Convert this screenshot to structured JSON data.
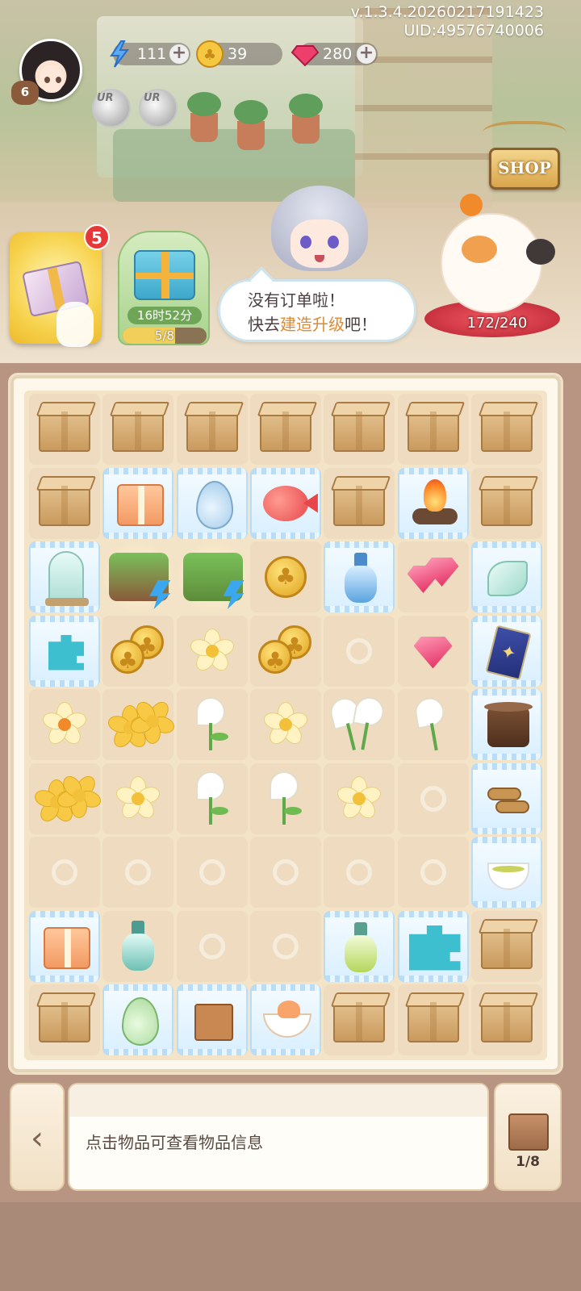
{
  "header": {
    "version": "v.1.3.4.20260217191423",
    "uid": "UID:49576740006",
    "player_level": "6",
    "energy": "111",
    "coins": "39",
    "gems": "280",
    "badge_1": "UR",
    "badge_2": "UR",
    "shop_label": "SHOP"
  },
  "gift_button": {
    "notification_count": "5"
  },
  "timed_chest": {
    "timer": "16时52分",
    "progress": "5/8",
    "progress_fraction": 0.625
  },
  "dialog": {
    "line1": "没有订单啦！",
    "line2_prefix": "快去",
    "line2_highlight": "建造升级",
    "line2_suffix": "吧！"
  },
  "lucky_cat": {
    "counter": "172/240"
  },
  "board": {
    "columns": 7,
    "rows": 9,
    "cells": [
      [
        "crate",
        "crate",
        "crate",
        "crate",
        "crate",
        "crate",
        "crate"
      ],
      [
        "crate",
        "giftbox*",
        "waterdrop*",
        "fish*",
        "crate",
        "campfire*",
        "crate"
      ],
      [
        "flower-dome*",
        "garden-bed!",
        "garden-arch!",
        "coin",
        "blue-bottle*",
        "gems",
        "shell*"
      ],
      [
        "puzzle-piece*",
        "coin-stack",
        "white-flower",
        "coin-stack",
        "empty",
        "gem",
        "tarot-card*"
      ],
      [
        "white-flower-orange",
        "yellow-flowers",
        "calla-lily",
        "white-flower",
        "calla-lilies",
        "calla-lily-2",
        "stove*"
      ],
      [
        "yellow-flowers",
        "white-flower",
        "calla-lily",
        "calla-lily",
        "white-flower",
        "empty",
        "logs*"
      ],
      [
        "empty",
        "empty",
        "empty",
        "empty",
        "empty",
        "empty",
        "teacup*"
      ],
      [
        "giftbox*",
        "teal-bottle",
        "empty",
        "empty",
        "lime-bottle*",
        "puzzle-pieces*",
        "crate"
      ],
      [
        "crate",
        "green-drop*",
        "stool*",
        "cat-teacup*",
        "crate",
        "crate",
        "crate"
      ]
    ]
  },
  "bottom_bar": {
    "back_icon": "‹",
    "info_text": "点击物品可查看物品信息",
    "bag_count": "1/8"
  },
  "colors": {
    "accent_red": "#e63838",
    "highlight_orange": "#e08a2e",
    "board_bg": "#f3e3c7"
  }
}
